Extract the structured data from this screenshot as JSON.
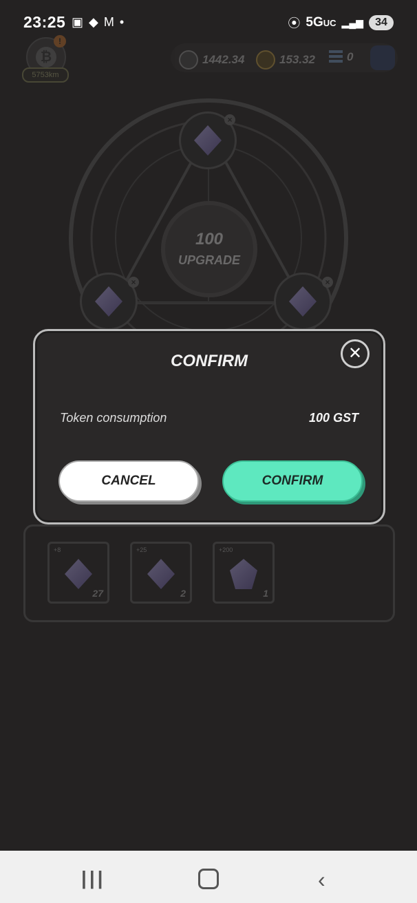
{
  "status_bar": {
    "time": "23:25",
    "network": "5G",
    "network_suffix": "UC",
    "battery": "34",
    "icons_left": [
      "screenshot-icon",
      "brave-icon",
      "gmail-icon",
      "dot-icon"
    ],
    "icons_right": [
      "location-icon",
      "signal-icon"
    ]
  },
  "game": {
    "distance_label": "5753km",
    "notification_badge": "!",
    "balances": {
      "gst": "1442.34",
      "gmt": "153.32",
      "other": "0"
    },
    "upgrade": {
      "amount": "100",
      "label": "UPGRADE"
    },
    "inventory": [
      {
        "tag": "+8",
        "count": "27"
      },
      {
        "tag": "+25",
        "count": "2"
      },
      {
        "tag": "+200",
        "count": "1"
      }
    ]
  },
  "modal": {
    "title": "CONFIRM",
    "close_symbol": "✕",
    "row_label": "Token consumption",
    "row_value": "100 GST",
    "cancel_label": "CANCEL",
    "confirm_label": "CONFIRM"
  },
  "colors": {
    "confirm_button": "#5ee8bf",
    "modal_bg": "#2a2828",
    "page_bg": "#242222"
  }
}
